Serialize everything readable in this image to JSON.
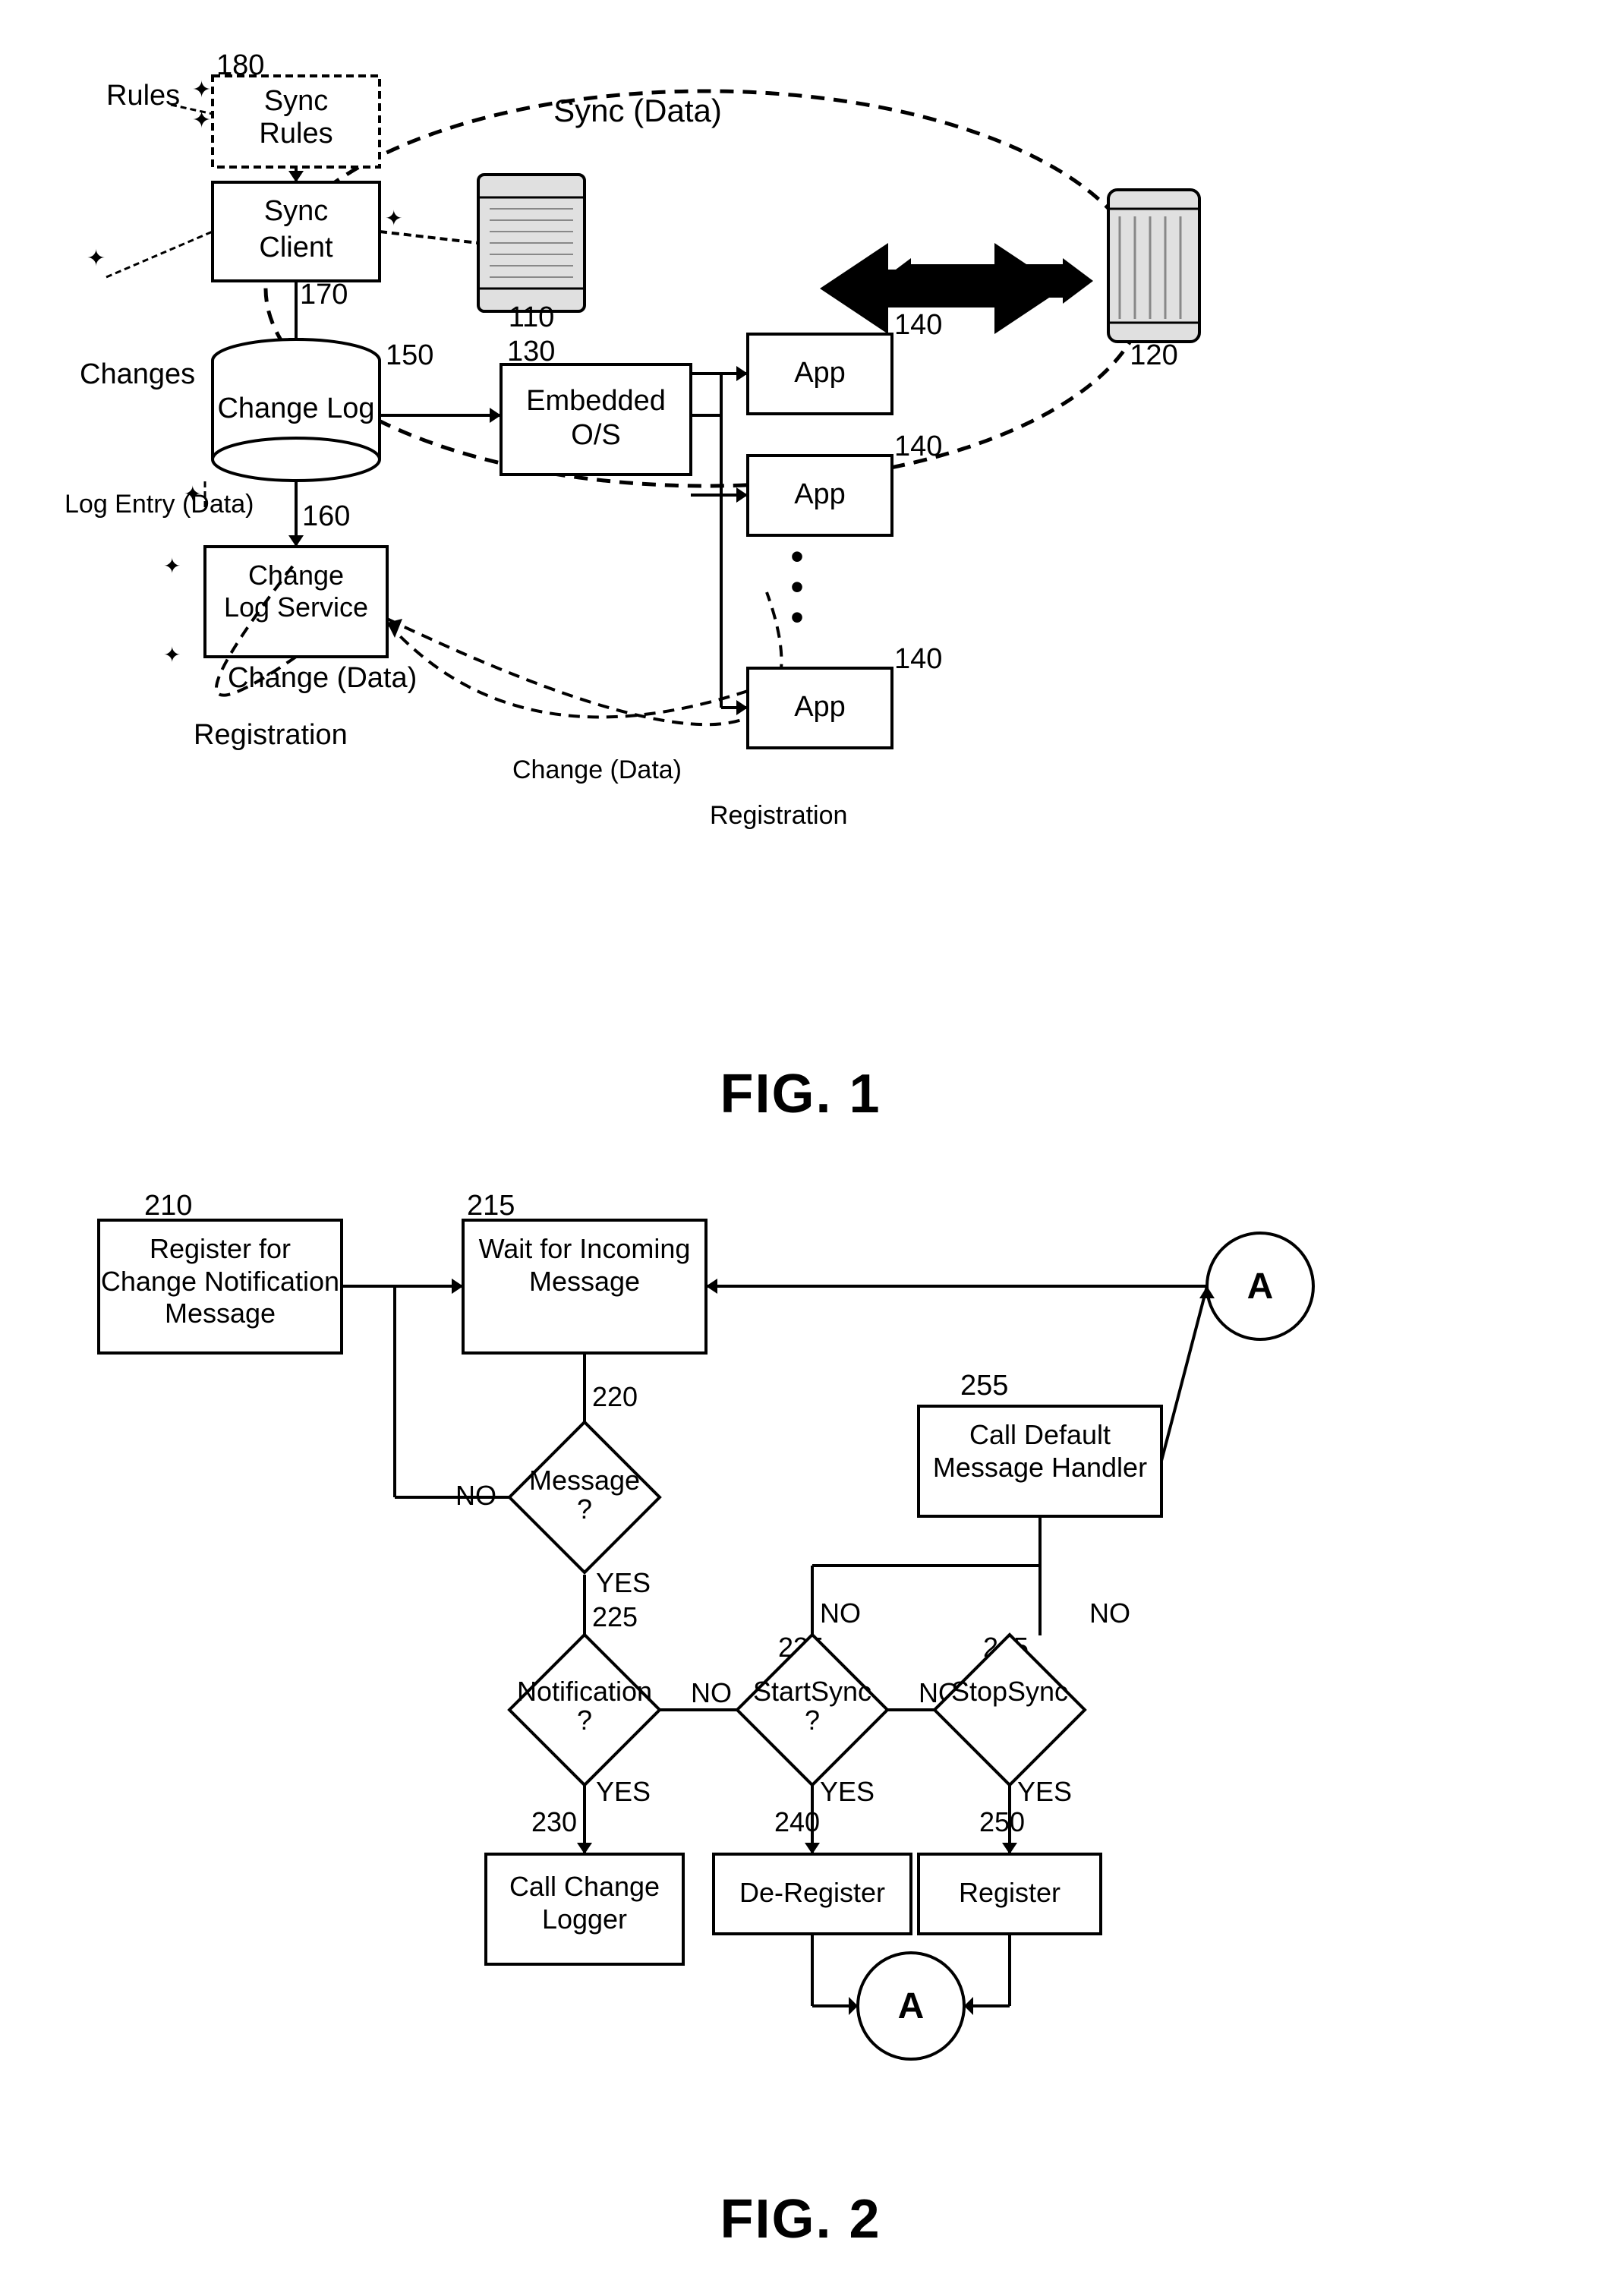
{
  "fig1": {
    "title": "FIG. 1",
    "nodes": {
      "sync_rules": {
        "label": "Sync\nRules",
        "number": "180"
      },
      "sync_client": {
        "label": "Sync\nClient",
        "number": "170"
      },
      "change_log": {
        "label": "Change Log",
        "number": "150"
      },
      "change_log_service": {
        "label": "Change\nLog Service",
        "number": "160"
      },
      "embedded_os": {
        "label": "Embedded\nO/S",
        "number": "130"
      },
      "app1": {
        "label": "App",
        "number": "140"
      },
      "app2": {
        "label": "App",
        "number": "140"
      },
      "app3": {
        "label": "App",
        "number": "140"
      },
      "device_left": {
        "number": "110"
      },
      "device_right": {
        "number": "120"
      }
    },
    "labels": {
      "rules": "Rules",
      "changes": "Changes",
      "log_entry": "Log Entry (Data)",
      "change_data": "Change (Data)",
      "registration": "Registration",
      "sync_data": "Sync (Data)"
    }
  },
  "fig2": {
    "title": "FIG. 2",
    "nodes": {
      "register": {
        "label": "Register for\nChange Notification\nMessage",
        "number": "210"
      },
      "wait": {
        "label": "Wait for Incoming\nMessage",
        "number": "215"
      },
      "message_q": {
        "label": "Message\n?",
        "number": "220"
      },
      "notification_q": {
        "label": "Notification\n?",
        "number": "225"
      },
      "startsync_q": {
        "label": "StartSync\n?",
        "number": "235"
      },
      "stopsync_q": {
        "label": "StopSync",
        "number": "245"
      },
      "call_change_logger": {
        "label": "Call Change\nLogger",
        "number": "230"
      },
      "de_register": {
        "label": "De-Register",
        "number": "240"
      },
      "register2": {
        "label": "Register",
        "number": "250"
      },
      "call_default": {
        "label": "Call Default\nMessage Handler",
        "number": "255"
      },
      "circle_a1": {
        "label": "A"
      },
      "circle_a2": {
        "label": "A"
      }
    },
    "labels": {
      "no1": "NO",
      "yes1": "YES",
      "no2": "NO",
      "yes2": "YES",
      "no3": "NO",
      "yes3": "YES",
      "no4": "NO",
      "yes4": "YES"
    }
  }
}
